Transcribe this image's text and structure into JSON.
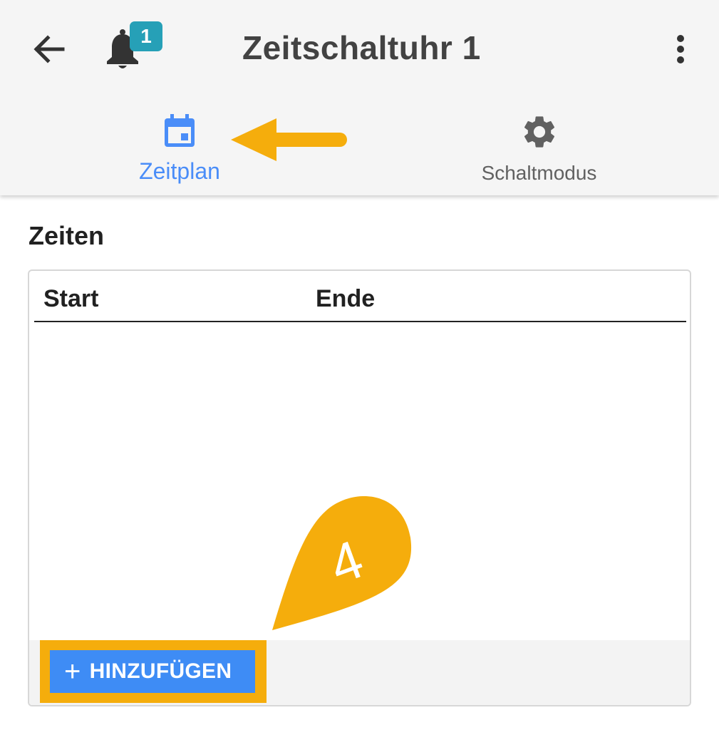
{
  "appbar": {
    "title": "Zeitschaltuhr 1",
    "notification_count": "1"
  },
  "tabs": [
    {
      "label": "Zeitplan",
      "icon": "calendar-icon",
      "active": true
    },
    {
      "label": "Schaltmodus",
      "icon": "gear-icon",
      "active": false
    }
  ],
  "section": {
    "title": "Zeiten"
  },
  "table": {
    "columns": [
      "Start",
      "Ende"
    ],
    "rows": []
  },
  "actions": {
    "add_label": "HINZUFÜGEN"
  },
  "annotations": {
    "step_number": "4"
  },
  "colors": {
    "accent": "#4a8df8",
    "button": "#3e8cf5",
    "badge": "#26a0b7",
    "highlight": "#f5ad0c"
  }
}
